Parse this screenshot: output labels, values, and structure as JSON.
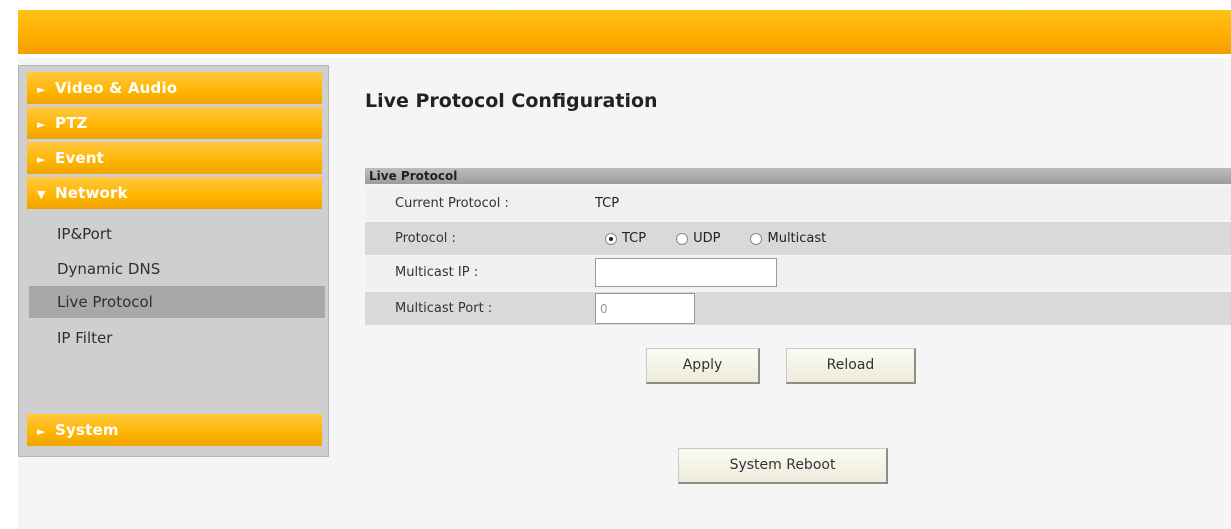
{
  "sidebar": {
    "groups": [
      {
        "label": "Video & Audio",
        "arrow": "►"
      },
      {
        "label": "PTZ",
        "arrow": "►"
      },
      {
        "label": "Event",
        "arrow": "►"
      },
      {
        "label": "Network",
        "arrow": "▼"
      }
    ],
    "network_items": [
      {
        "label": "IP&Port"
      },
      {
        "label": "Dynamic DNS"
      },
      {
        "label": "Live Protocol",
        "active": true
      },
      {
        "label": "IP Filter"
      }
    ],
    "system": {
      "label": "System",
      "arrow": "►"
    }
  },
  "main": {
    "title": "Live Protocol Configuration",
    "section_title": "Live Protocol",
    "current_protocol_label": "Current Protocol :",
    "current_protocol_value": "TCP",
    "protocol_label": "Protocol :",
    "protocol_options": [
      "TCP",
      "UDP",
      "Multicast"
    ],
    "protocol_selected": "TCP",
    "multicast_ip_label": "Multicast IP :",
    "multicast_ip_value": "",
    "multicast_port_label": "Multicast Port :",
    "multicast_port_value": "0",
    "apply_label": "Apply",
    "reload_label": "Reload",
    "reboot_label": "System Reboot"
  },
  "colors": {
    "topbar": "#ffb000",
    "menu_orange": "#ffb400",
    "active_item": "#a8a8a8"
  }
}
